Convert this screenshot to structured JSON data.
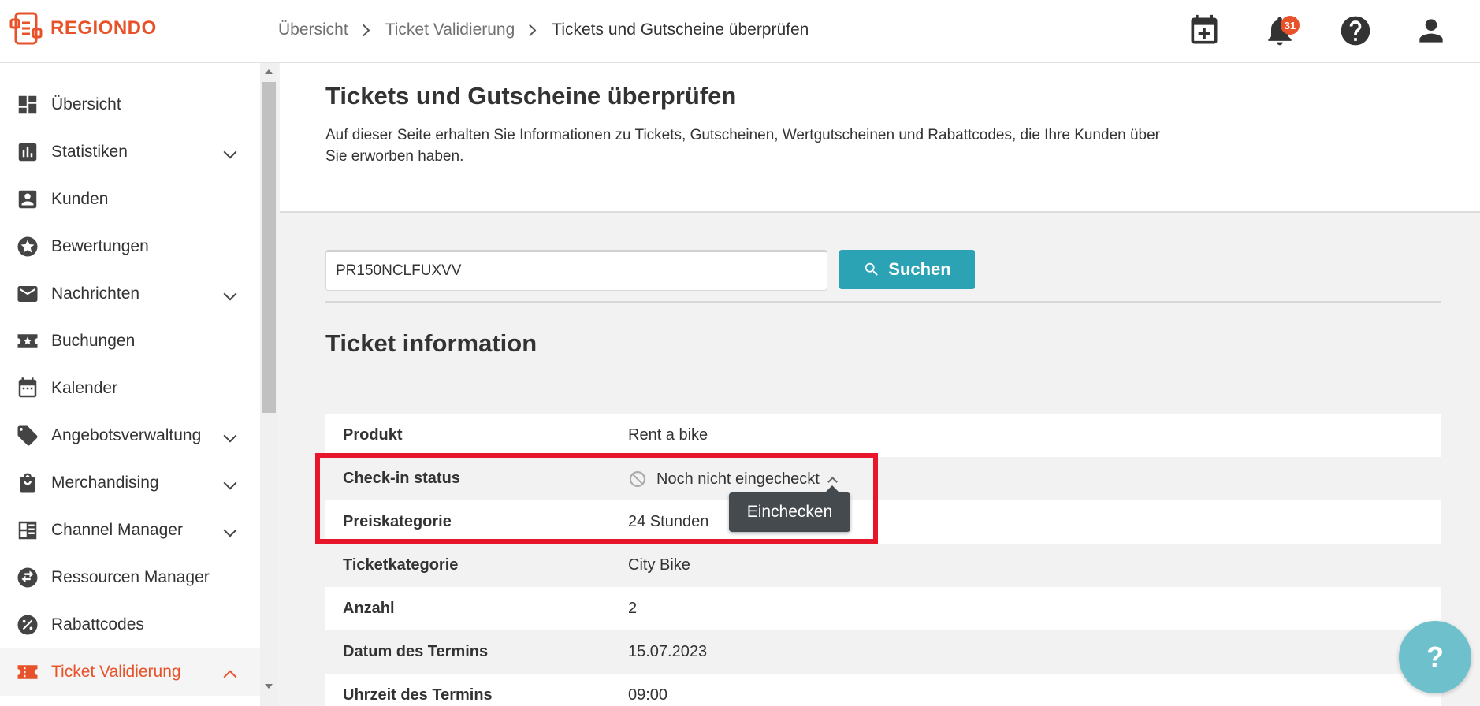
{
  "brand": {
    "name": "REGIONDO",
    "accent": "#e8522a",
    "teal": "#2ca3b4"
  },
  "breadcrumb": [
    "Übersicht",
    "Ticket Validierung",
    "Tickets und Gutscheine überprüfen"
  ],
  "header": {
    "notification_count": "31"
  },
  "sidebar": {
    "items": [
      {
        "label": "Übersicht",
        "icon": "dashboard-icon",
        "expandable": false
      },
      {
        "label": "Statistiken",
        "icon": "bar-chart-icon",
        "expandable": true
      },
      {
        "label": "Kunden",
        "icon": "contact-icon",
        "expandable": false
      },
      {
        "label": "Bewertungen",
        "icon": "star-icon",
        "expandable": false
      },
      {
        "label": "Nachrichten",
        "icon": "mail-icon",
        "expandable": true
      },
      {
        "label": "Buchungen",
        "icon": "booking-icon",
        "expandable": false
      },
      {
        "label": "Kalender",
        "icon": "calendar-icon",
        "expandable": false
      },
      {
        "label": "Angebotsverwaltung",
        "icon": "tag-icon",
        "expandable": true
      },
      {
        "label": "Merchandising",
        "icon": "shopping-bag-icon",
        "expandable": true
      },
      {
        "label": "Channel Manager",
        "icon": "list-icon",
        "expandable": true
      },
      {
        "label": "Ressourcen Manager",
        "icon": "swap-icon",
        "expandable": false
      },
      {
        "label": "Rabattcodes",
        "icon": "percent-icon",
        "expandable": false
      },
      {
        "label": "Ticket Validierung",
        "icon": "ticket-icon",
        "expandable": true,
        "active": true
      }
    ]
  },
  "page": {
    "title": "Tickets und Gutscheine überprüfen",
    "description": "Auf dieser Seite erhalten Sie Informationen zu Tickets, Gutscheinen, Wertgutscheinen und Rabattcodes, die Ihre Kunden über Sie erworben haben."
  },
  "search": {
    "value": "PR150NCLFUXVV",
    "button_label": "Suchen"
  },
  "ticket": {
    "section_title": "Ticket information",
    "rows": [
      {
        "key": "Produkt",
        "value": "Rent a bike"
      },
      {
        "key": "Check-in status",
        "value": "Noch nicht eingecheckt"
      },
      {
        "key": "Preiskategorie",
        "value": "24 Stunden"
      },
      {
        "key": "Ticketkategorie",
        "value": "City Bike"
      },
      {
        "key": "Anzahl",
        "value": "2"
      },
      {
        "key": "Datum des Termins",
        "value": "15.07.2023"
      },
      {
        "key": "Uhrzeit des Termins",
        "value": "09:00"
      }
    ]
  },
  "tooltip": {
    "label": "Einchecken"
  },
  "help_fab": {
    "label": "?"
  }
}
